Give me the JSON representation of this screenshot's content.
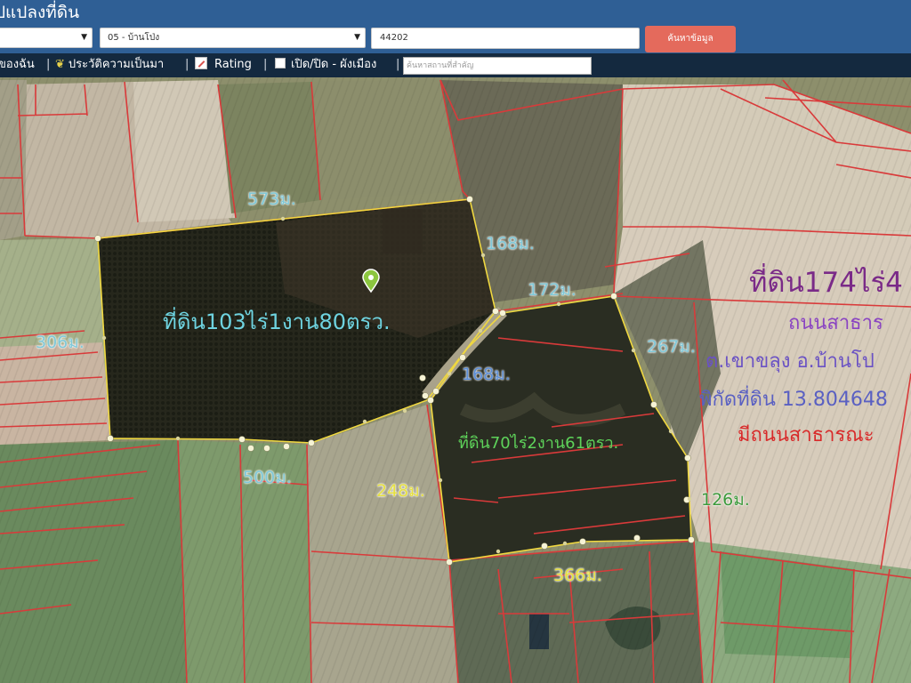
{
  "header": {
    "title": "ปแปลงที่ดิน",
    "province_select": "",
    "district_select": "05 - บ้านโป่ง",
    "parcel_input": "44202",
    "search_button": "ค้นหาข้อมูล"
  },
  "toolbar": {
    "my_item": "ของฉัน",
    "history": "ประวัติความเป็นมา",
    "rating": "Rating",
    "zoning": "เปิด/ปิด - ผังเมือง",
    "search_placeholder": "ค้นหาสถานที่สำคัญ",
    "separator": "|"
  },
  "map": {
    "plot_labels": {
      "plot_a": "ที่ดิน103ไร่1งาน80ตรว.",
      "plot_b": "ที่ดิน70ไร่2งาน61ตรว."
    },
    "measurements": {
      "m573": "573ม.",
      "m168_top": "168ม.",
      "m172": "172ม.",
      "m306": "306ม.",
      "m168_mid": "168ม.",
      "m267": "267ม.",
      "m500": "500ม.",
      "m248": "248ม.",
      "m126": "126ม.",
      "m366": "366ม."
    },
    "info": {
      "line1": "ที่ดิน174ไร่4",
      "line2": "ถนนสาธาร",
      "line3": "ต.เขาขลุง อ.บ้านโป",
      "line4": "พิกัดที่ดิน 13.804648",
      "line5": "มีถนนสาธารณะ"
    },
    "colors": {
      "boundary": "#d93a3a",
      "plot_outline": "#f0d840",
      "vertex": "#f6f3d6"
    }
  }
}
